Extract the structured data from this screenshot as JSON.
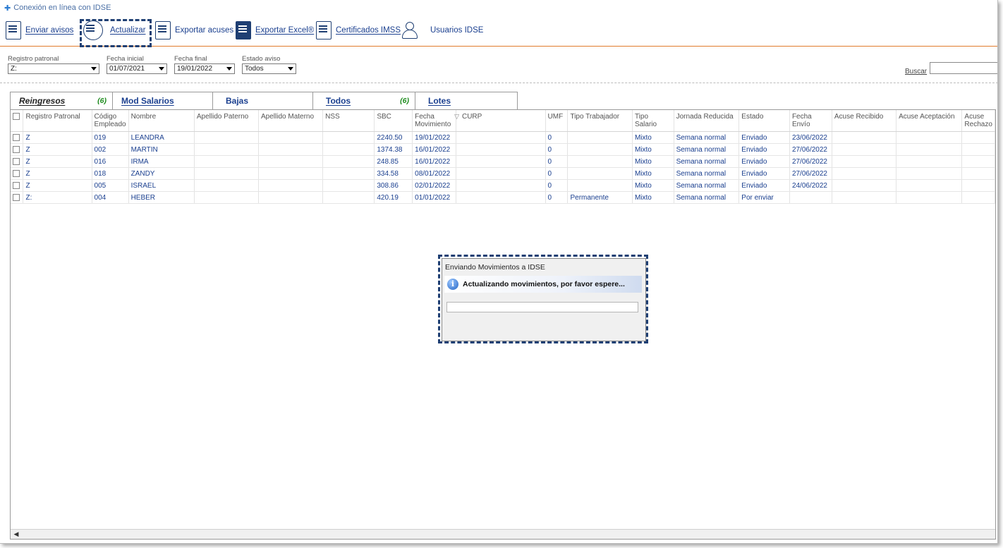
{
  "window": {
    "title": "Conexión en línea con IDSE"
  },
  "toolbar": {
    "items": [
      {
        "label": "Enviar avisos",
        "icon": "send-document-icon"
      },
      {
        "label": "Actualizar",
        "icon": "refresh-document-icon"
      },
      {
        "label": "Exportar acuses",
        "icon": "export-receipts-icon"
      },
      {
        "label": "Exportar Excel®",
        "icon": "excel-export-icon"
      },
      {
        "label": "Certificados IMSS",
        "icon": "certificate-icon"
      },
      {
        "label": "Usuarios IDSE",
        "icon": "user-icon"
      }
    ]
  },
  "filters": {
    "registro_patronal": {
      "label": "Registro patronal",
      "value": "Z:"
    },
    "fecha_inicial": {
      "label": "Fecha inicial",
      "value": "01/07/2021"
    },
    "fecha_final": {
      "label": "Fecha final",
      "value": "19/01/2022"
    },
    "estado_aviso": {
      "label": "Estado aviso",
      "value": "Todos"
    },
    "buscar": {
      "label": "Buscar",
      "value": ""
    }
  },
  "tabs": [
    {
      "label": "Reingresos",
      "count": "(6)",
      "active": true
    },
    {
      "label": "Mod Salarios",
      "count": ""
    },
    {
      "label": "Bajas",
      "count": ""
    },
    {
      "label": "Todos",
      "count": "(6)"
    },
    {
      "label": "Lotes",
      "count": ""
    }
  ],
  "grid": {
    "columns": [
      "Registro Patronal",
      "Código Empleado",
      "Nombre",
      "Apellido Paterno",
      "Apellido Materno",
      "NSS",
      "SBC",
      "Fecha Movimiento",
      "CURP",
      "UMF",
      "Tipo Trabajador",
      "Tipo Salario",
      "Jornada Reducida",
      "Estado",
      "Fecha Envío",
      "Acuse Recibido",
      "Acuse Aceptación",
      "Acuse Rechazo"
    ],
    "rows": [
      [
        "Z",
        "019",
        "LEANDRA",
        "",
        "",
        "",
        "2240.50",
        "19/01/2022",
        "",
        "0",
        "",
        "Mixto",
        "Semana normal",
        "Enviado",
        "23/06/2022",
        "",
        "",
        ""
      ],
      [
        "Z",
        "002",
        "MARTIN",
        "",
        "",
        "",
        "1374.38",
        "16/01/2022",
        "",
        "0",
        "",
        "Mixto",
        "Semana normal",
        "Enviado",
        "27/06/2022",
        "",
        "",
        ""
      ],
      [
        "Z",
        "016",
        "IRMA",
        "",
        "",
        "",
        "248.85",
        "16/01/2022",
        "",
        "0",
        "",
        "Mixto",
        "Semana normal",
        "Enviado",
        "27/06/2022",
        "",
        "",
        ""
      ],
      [
        "Z",
        "018",
        "ZANDY",
        "",
        "",
        "",
        "334.58",
        "08/01/2022",
        "",
        "0",
        "",
        "Mixto",
        "Semana normal",
        "Enviado",
        "27/06/2022",
        "",
        "",
        ""
      ],
      [
        "Z",
        "005",
        "ISRAEL",
        "",
        "",
        "",
        "308.86",
        "02/01/2022",
        "",
        "0",
        "",
        "Mixto",
        "Semana normal",
        "Enviado",
        "24/06/2022",
        "",
        "",
        ""
      ],
      [
        "Z:",
        "004",
        "HEBER",
        "",
        "",
        "",
        "420.19",
        "01/01/2022",
        "",
        "0",
        "Permanente",
        "Mixto",
        "Semana normal",
        "Por enviar",
        "",
        "",
        "",
        ""
      ]
    ]
  },
  "dialog": {
    "title": "Enviando Movimientos a IDSE",
    "message": "Actualizando movimientos, por favor espere...",
    "progress": 0
  }
}
